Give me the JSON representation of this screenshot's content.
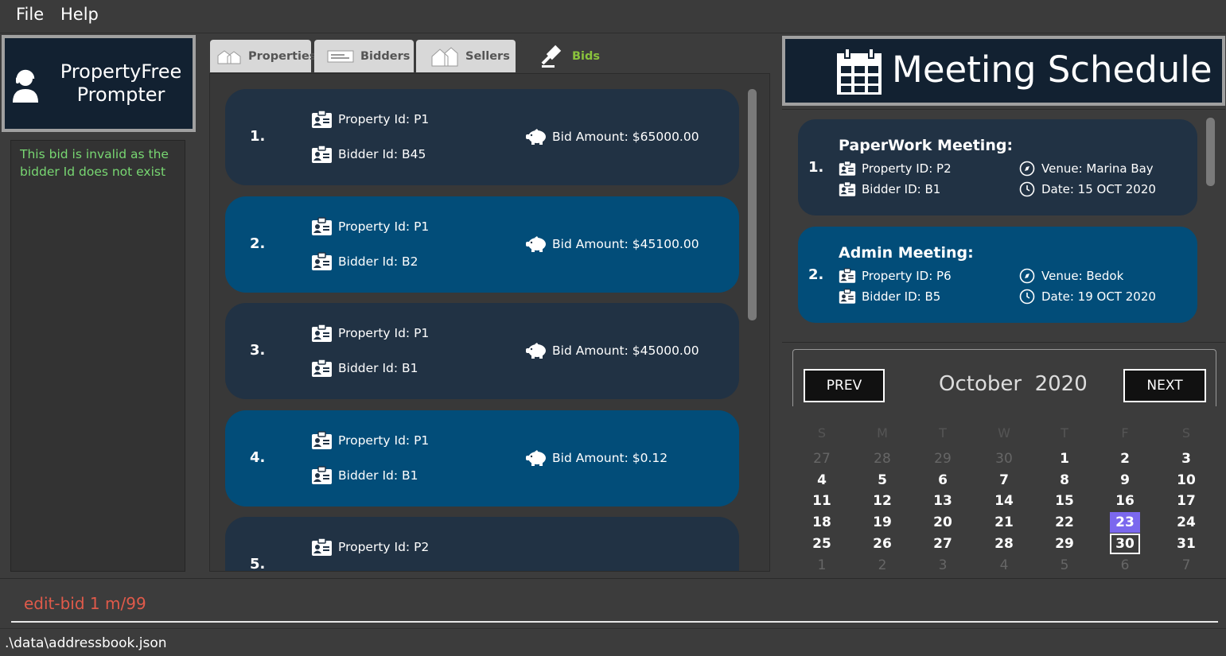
{
  "menu": {
    "file": "File",
    "help": "Help"
  },
  "app": {
    "title_line1": "PropertyFree",
    "title_line2": "Prompter"
  },
  "result_message": "This bid is invalid as the bidder Id does not exist",
  "tabs": [
    {
      "label": "Properties",
      "icon": "house-icon"
    },
    {
      "label": "Bidders",
      "icon": "card-icon"
    },
    {
      "label": "Sellers",
      "icon": "houses-icon"
    },
    {
      "label": "Bids",
      "icon": "gavel-icon",
      "active": true
    }
  ],
  "bids": [
    {
      "index": "1.",
      "property": "Property Id: P1",
      "bidder": "Bidder Id: B45",
      "amount": "Bid Amount: $65000.00",
      "style": "dark"
    },
    {
      "index": "2.",
      "property": "Property Id: P1",
      "bidder": "Bidder Id: B2",
      "amount": "Bid Amount: $45100.00",
      "style": "blue"
    },
    {
      "index": "3.",
      "property": "Property Id: P1",
      "bidder": "Bidder Id: B1",
      "amount": "Bid Amount: $45000.00",
      "style": "dark"
    },
    {
      "index": "4.",
      "property": "Property Id: P1",
      "bidder": "Bidder Id: B1",
      "amount": "Bid Amount: $0.12",
      "style": "blue"
    },
    {
      "index": "5.",
      "property": "Property Id: P2",
      "bidder": "",
      "amount": "",
      "style": "dark"
    }
  ],
  "schedule": {
    "title": "Meeting Schedule",
    "meetings": [
      {
        "index": "1.",
        "title": "PaperWork Meeting:",
        "property": "Property ID: P2",
        "bidder": "Bidder ID: B1",
        "venue": "Venue: Marina Bay",
        "date": "Date: 15 OCT 2020",
        "style": "dark"
      },
      {
        "index": "2.",
        "title": "Admin Meeting:",
        "property": "Property ID: P6",
        "bidder": "Bidder ID: B5",
        "venue": "Venue: Bedok",
        "date": "Date: 19 OCT 2020",
        "style": "blue"
      }
    ]
  },
  "calendar": {
    "prev": "PREV",
    "next": "NEXT",
    "month": "October",
    "year": "2020",
    "weekdays": [
      "S",
      "M",
      "T",
      "W",
      "T",
      "F",
      "S"
    ],
    "weeks": [
      [
        "27",
        "28",
        "29",
        "30",
        "1",
        "2",
        "3"
      ],
      [
        "4",
        "5",
        "6",
        "7",
        "8",
        "9",
        "10"
      ],
      [
        "11",
        "12",
        "13",
        "14",
        "15",
        "16",
        "17"
      ],
      [
        "18",
        "19",
        "20",
        "21",
        "22",
        "23",
        "24"
      ],
      [
        "25",
        "26",
        "27",
        "28",
        "29",
        "30",
        "31"
      ],
      [
        "1",
        "2",
        "3",
        "4",
        "5",
        "6",
        "7"
      ]
    ],
    "today": "23",
    "selected": "30",
    "colors": {
      "today": "#7b68ee"
    }
  },
  "command": {
    "text": "edit-bid 1 m/99",
    "color": "#e05a4a"
  },
  "status": {
    "path": ".\\data\\addressbook.json"
  }
}
